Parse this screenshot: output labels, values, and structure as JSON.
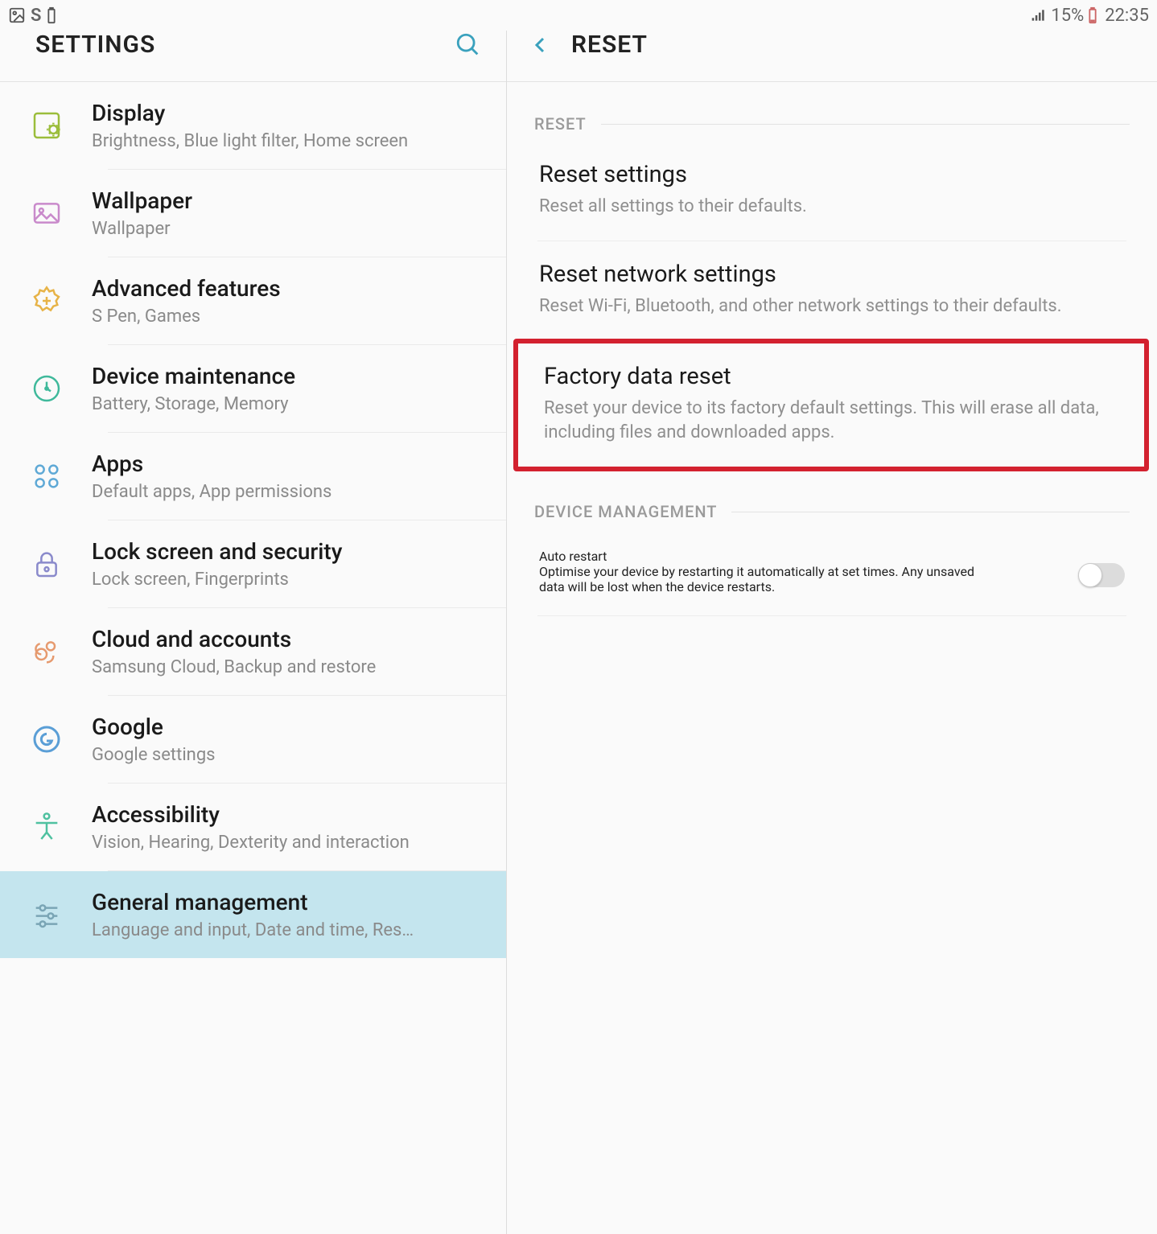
{
  "status_bar": {
    "battery_pct": "15%",
    "time": "22:35"
  },
  "left": {
    "title": "SETTINGS",
    "items": [
      {
        "title": "Display",
        "subtitle": "Brightness, Blue light filter, Home screen"
      },
      {
        "title": "Wallpaper",
        "subtitle": "Wallpaper"
      },
      {
        "title": "Advanced features",
        "subtitle": "S Pen, Games"
      },
      {
        "title": "Device maintenance",
        "subtitle": "Battery, Storage, Memory"
      },
      {
        "title": "Apps",
        "subtitle": "Default apps, App permissions"
      },
      {
        "title": "Lock screen and security",
        "subtitle": "Lock screen, Fingerprints"
      },
      {
        "title": "Cloud and accounts",
        "subtitle": "Samsung Cloud, Backup and restore"
      },
      {
        "title": "Google",
        "subtitle": "Google settings"
      },
      {
        "title": "Accessibility",
        "subtitle": "Vision, Hearing, Dexterity and interaction"
      },
      {
        "title": "General management",
        "subtitle": "Language and input, Date and time, Res…"
      }
    ]
  },
  "right": {
    "title": "RESET",
    "section_reset_label": "RESET",
    "reset_items": [
      {
        "title": "Reset settings",
        "subtitle": "Reset all settings to their defaults."
      },
      {
        "title": "Reset network settings",
        "subtitle": "Reset Wi-Fi, Bluetooth, and other network settings to their defaults."
      },
      {
        "title": "Factory data reset",
        "subtitle": "Reset your device to its factory default settings. This will erase all data, including files and downloaded apps."
      }
    ],
    "section_dm_label": "DEVICE MANAGEMENT",
    "auto_restart": {
      "title": "Auto restart",
      "subtitle": "Optimise your device by restarting it automatically at set times. Any unsaved data will be lost when the device restarts."
    }
  }
}
